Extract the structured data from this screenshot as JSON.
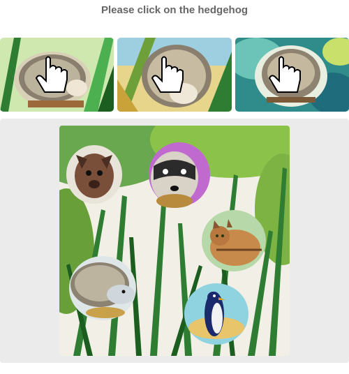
{
  "prompt": {
    "text": "Please click on the hedgehog"
  },
  "examples": [
    {
      "subject": "hedgehog",
      "overlay_icon": "hand-pointer-icon",
      "background": "green-leaves"
    },
    {
      "subject": "hedgehog",
      "overlay_icon": "hand-pointer-icon",
      "background": "leaves-yellow-sky"
    },
    {
      "subject": "hedgehog",
      "overlay_icon": "hand-pointer-icon",
      "background": "teal-swirl"
    }
  ],
  "challenge": {
    "background": "jungle-leaves-watercolor",
    "animals": [
      "bat",
      "raccoon",
      "cat",
      "hedgehog",
      "penguin"
    ]
  },
  "colors": {
    "title": "#666666",
    "panel_bg": "#ebebeb",
    "leaf_green": "#2e7d32",
    "leaf_light": "#8bc34a"
  }
}
